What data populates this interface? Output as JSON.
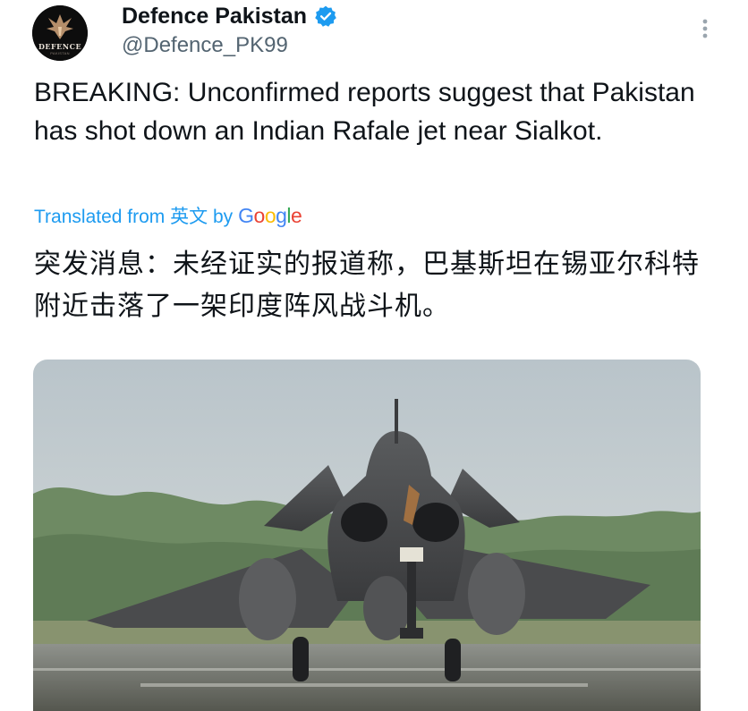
{
  "account": {
    "display_name": "Defence Pakistan",
    "handle": "@Defence_PK99",
    "avatar_text": "DEFENCE",
    "avatar_subtext": "PAKISTAN",
    "verified_color": "#1d9bf0"
  },
  "tweet": {
    "text": "BREAKING: Unconfirmed reports suggest that Pakistan has shot down an Indian Rafale jet near Sialkot.",
    "translated_label": "Translated from 英文 by",
    "translator_brand": "Google",
    "translation": "突发消息：未经证实的报道称，巴基斯坦在锡亚尔科特附近击落了一架印度阵风战斗机。"
  },
  "icons": {
    "more": "more-options-icon",
    "verified": "verified-badge-icon"
  },
  "colors": {
    "text": "#0f1419",
    "secondary_text": "#536471",
    "link": "#1d9bf0"
  }
}
